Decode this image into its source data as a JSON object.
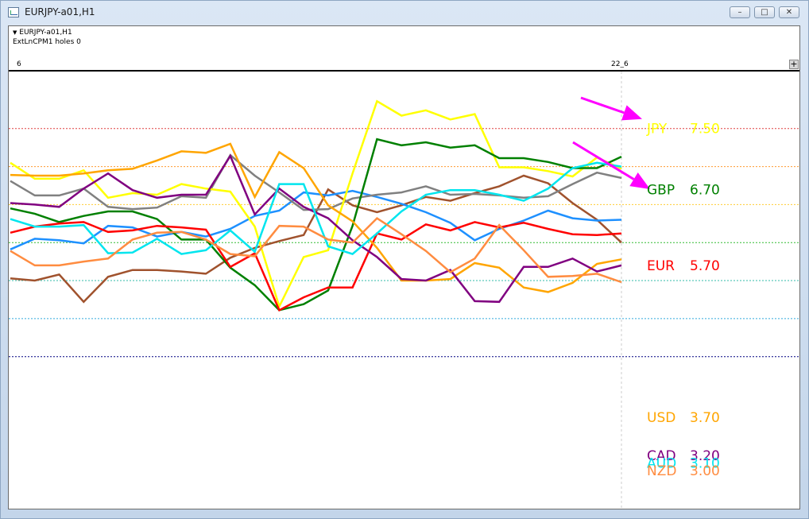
{
  "window": {
    "title": "EURJPY-a01,H1",
    "minimize_label": "–",
    "maximize_label": "□",
    "close_label": "✕"
  },
  "info": {
    "symbol_line": "EURJPY-a01,H1",
    "indicator_line": "ExtLnCPM1 holes 0",
    "dropdown_glyph": "▼"
  },
  "scale": {
    "left_label": "6",
    "right_label": "22_6",
    "plus_label": "+"
  },
  "chart_data": {
    "type": "line",
    "ylim": [
      2.5,
      8.25
    ],
    "x_count": 26,
    "series": [
      {
        "name": "JPY",
        "value_label": "7.50",
        "color": "#ffff00",
        "level": 7.5,
        "values": [
          7.05,
          6.84,
          6.84,
          6.95,
          6.59,
          6.65,
          6.63,
          6.77,
          6.71,
          6.67,
          6.21,
          5.16,
          5.81,
          5.9,
          6.91,
          7.86,
          7.67,
          7.74,
          7.62,
          7.69,
          6.99,
          6.99,
          6.94,
          6.87,
          7.12,
          6.97
        ]
      },
      {
        "name": "GBP",
        "value_label": "6.70",
        "color": "#008000",
        "level": 6.7,
        "values": [
          6.45,
          6.38,
          6.27,
          6.35,
          6.41,
          6.41,
          6.31,
          6.04,
          6.04,
          5.67,
          5.44,
          5.11,
          5.19,
          5.37,
          6.22,
          7.36,
          7.28,
          7.32,
          7.25,
          7.28,
          7.11,
          7.11,
          7.06,
          6.98,
          6.98,
          7.13
        ]
      },
      {
        "name": "EUR",
        "value_label": "5.70",
        "color": "#ff0000",
        "level": 5.7,
        "values": [
          6.13,
          6.21,
          6.25,
          6.27,
          6.14,
          6.16,
          6.22,
          6.2,
          6.17,
          5.68,
          5.86,
          5.11,
          5.28,
          5.41,
          5.41,
          6.12,
          6.04,
          6.24,
          6.16,
          6.27,
          6.2,
          6.26,
          6.18,
          6.11,
          6.1,
          6.12
        ]
      },
      {
        "name": "USD",
        "value_label": "3.70",
        "color": "#ffa500",
        "level": 3.7,
        "values": [
          6.89,
          6.88,
          6.88,
          6.91,
          6.95,
          6.97,
          7.08,
          7.2,
          7.18,
          7.3,
          6.6,
          7.19,
          6.98,
          6.49,
          6.28,
          5.93,
          5.5,
          5.5,
          5.52,
          5.73,
          5.67,
          5.41,
          5.35,
          5.47,
          5.72,
          5.78
        ]
      },
      {
        "name": "CAD",
        "value_label": "3.20",
        "color": "#800080",
        "level": 3.2,
        "values": [
          6.52,
          6.5,
          6.47,
          6.71,
          6.91,
          6.69,
          6.59,
          6.63,
          6.63,
          7.14,
          6.37,
          6.71,
          6.47,
          6.32,
          6.03,
          5.81,
          5.52,
          5.5,
          5.64,
          5.23,
          5.22,
          5.68,
          5.68,
          5.79,
          5.62,
          5.7
        ]
      },
      {
        "name": "AUD",
        "value_label": "3.10",
        "color": "#00e5ee",
        "level": 3.1,
        "values": [
          6.31,
          6.21,
          6.21,
          6.23,
          5.86,
          5.87,
          6.05,
          5.85,
          5.9,
          6.16,
          5.88,
          6.77,
          6.77,
          5.95,
          5.85,
          6.12,
          6.41,
          6.63,
          6.69,
          6.69,
          6.63,
          6.55,
          6.71,
          6.98,
          7.05,
          7.0
        ]
      },
      {
        "name": "NZD",
        "value_label": "3.00",
        "color": "#ff8c40",
        "level": 3.0,
        "values": [
          5.89,
          5.7,
          5.7,
          5.75,
          5.79,
          6.04,
          6.13,
          6.14,
          6.04,
          5.85,
          5.82,
          6.22,
          6.21,
          6.04,
          6.0,
          6.32,
          6.11,
          5.89,
          5.61,
          5.79,
          6.23,
          5.9,
          5.55,
          5.56,
          5.59,
          5.48
        ]
      }
    ],
    "other_lines": [
      {
        "name": "brown",
        "color": "#a0522d",
        "values": [
          5.53,
          5.5,
          5.58,
          5.22,
          5.55,
          5.64,
          5.64,
          5.62,
          5.59,
          5.8,
          5.93,
          6.02,
          6.1,
          6.7,
          6.49,
          6.4,
          6.49,
          6.6,
          6.55,
          6.65,
          6.74,
          6.88,
          6.78,
          6.52,
          6.3,
          6.0
        ]
      },
      {
        "name": "blue",
        "color": "#1e90ff",
        "values": [
          5.91,
          6.05,
          6.03,
          5.99,
          6.22,
          6.2,
          6.08,
          6.14,
          6.08,
          6.18,
          6.35,
          6.42,
          6.66,
          6.62,
          6.68,
          6.6,
          6.51,
          6.4,
          6.26,
          6.03,
          6.18,
          6.29,
          6.42,
          6.32,
          6.29,
          6.3
        ]
      },
      {
        "name": "gray",
        "color": "#808080",
        "values": [
          6.81,
          6.62,
          6.62,
          6.71,
          6.47,
          6.44,
          6.46,
          6.61,
          6.59,
          7.15,
          6.88,
          6.66,
          6.43,
          6.44,
          6.58,
          6.63,
          6.66,
          6.74,
          6.63,
          6.64,
          6.62,
          6.59,
          6.61,
          6.77,
          6.92,
          6.85
        ]
      }
    ],
    "levels": [
      {
        "value": 7.5,
        "color": "#e04040"
      },
      {
        "value": 7.0,
        "color": "#ff9a2e"
      },
      {
        "value": 6.5,
        "color": "#ffcc33"
      },
      {
        "value": 6.0,
        "color": "#33bb33"
      },
      {
        "value": 5.5,
        "color": "#33bbaa"
      },
      {
        "value": 5.0,
        "color": "#33aadd"
      },
      {
        "value": 4.5,
        "color": "#000080"
      }
    ],
    "arrows_color": "#ff00ff",
    "grid": false
  }
}
